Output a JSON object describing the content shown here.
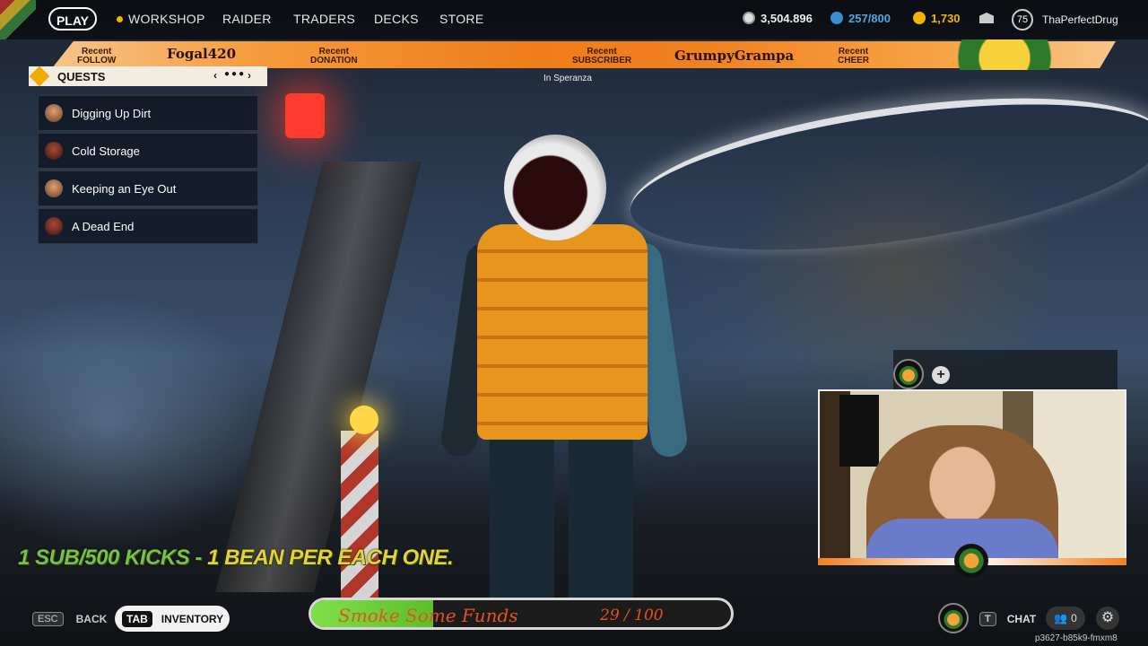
{
  "nav": {
    "play": "PLAY",
    "items": [
      "WORKSHOP",
      "RAIDER",
      "TRADERS",
      "DECKS",
      "STORE"
    ]
  },
  "currency": {
    "coins": "3,504.896",
    "tokens": "257/800",
    "credits": "1,730"
  },
  "user": {
    "level": "75",
    "name": "ThaPerfectDrug"
  },
  "banner": {
    "follow_label": [
      "Recent",
      "FOLLOW"
    ],
    "follow_name": "Fogal420",
    "donation_label": [
      "Recent",
      "DONATION"
    ],
    "subscriber_label": [
      "Recent",
      "SUBSCRIBER"
    ],
    "subscriber_name": "GrumpyGrampa",
    "cheer_label": [
      "Recent",
      "CHEER"
    ]
  },
  "quests": {
    "title": "QUESTS",
    "items": [
      "Digging Up Dirt",
      "Cold Storage",
      "Keeping an Eye Out",
      "A Dead End"
    ]
  },
  "location": "In Speranza",
  "promo": {
    "part1": "1 SUB/500 KICKS - ",
    "part2": "1 BEAN PER EACH ONE."
  },
  "goal": {
    "label": "Smoke Some Funds",
    "count": "29 / 100",
    "progress": 0.29
  },
  "controls": {
    "esc_key": "ESC",
    "back": "BACK",
    "tab_key": "TAB",
    "inventory": "INVENTORY",
    "chat_key": "T",
    "chat": "CHAT",
    "friends_count": "0"
  },
  "session_code": "p3627-b85k9-fmxm8",
  "colors": {
    "accent_orange": "#f07f1e",
    "goal_green": "#5bbf2a",
    "goal_text": "#e8501e"
  }
}
